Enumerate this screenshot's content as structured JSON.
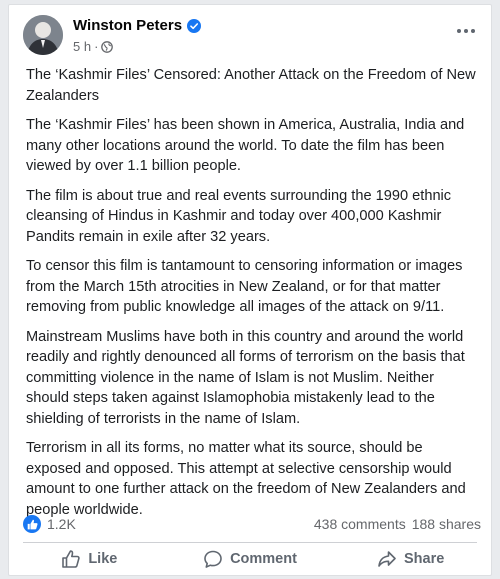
{
  "post": {
    "author": "Winston Peters",
    "time": "5 h",
    "separator": "·",
    "verified_icon": "verified-badge-icon",
    "audience_icon": "globe-icon",
    "paragraphs": [
      "The ‘Kashmir Files’ Censored: Another Attack on the Freedom of New Zealanders",
      "The ‘Kashmir Files’ has been shown in America, Australia, India and many other locations around the world.  To date the film has been viewed by over 1.1 billion people.",
      "The film is about true and real events surrounding the 1990 ethnic cleansing of Hindus in Kashmir and today over 400,000 Kashmir Pandits remain in exile after 32 years.",
      "To censor this film is tantamount to censoring information or images from the March 15th atrocities in New Zealand, or for that matter removing from public knowledge all images of the attack on 9/11.",
      "Mainstream Muslims have both in this country and around the world readily and rightly denounced all forms of terrorism on the basis that committing violence in the name of Islam is not Muslim.  Neither should steps taken against Islamophobia mistakenly lead to the shielding of terrorists in the name of Islam.",
      "Terrorism in all its forms, no matter what its source, should be exposed and opposed.  This attempt at selective censorship would amount to one further attack on the freedom of New Zealanders and people worldwide."
    ]
  },
  "engagement": {
    "reaction_count": "1.2K",
    "comments": "438 comments",
    "shares": "188 shares"
  },
  "actions": {
    "like": "Like",
    "comment": "Comment",
    "share": "Share"
  },
  "colors": {
    "brand_blue": "#1877f2",
    "muted_text": "#65676b"
  }
}
